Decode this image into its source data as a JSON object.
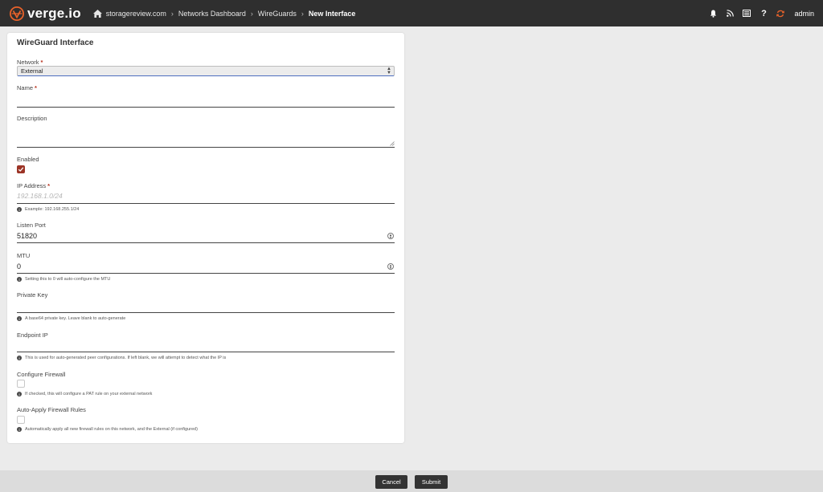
{
  "brand": {
    "name": "verge.io",
    "accent": "#e8622a"
  },
  "breadcrumbs": [
    "storagereview.com",
    "Networks Dashboard",
    "WireGuards",
    "New Interface"
  ],
  "header_icons": [
    "bell-icon",
    "rss-icon",
    "list-icon",
    "help-icon",
    "refresh-icon"
  ],
  "user": "admin",
  "form": {
    "title": "WireGuard Interface",
    "network": {
      "label": "Network",
      "value": "External"
    },
    "name": {
      "label": "Name",
      "value": ""
    },
    "description": {
      "label": "Description",
      "value": ""
    },
    "enabled": {
      "label": "Enabled",
      "checked": true
    },
    "ip_address": {
      "label": "IP Address",
      "placeholder": "192.168.1.0/24",
      "hint": "Example: 192.168.255.1/24"
    },
    "listen_port": {
      "label": "Listen Port",
      "value": "51820"
    },
    "mtu": {
      "label": "MTU",
      "value": "0",
      "hint": "Setting this to 0 will auto-configure the MTU"
    },
    "private_key": {
      "label": "Private Key",
      "value": "",
      "hint": "A base64 private key. Leave blank to auto-generate"
    },
    "endpoint_ip": {
      "label": "Endpoint IP",
      "value": "",
      "hint": "This is used for auto-generated peer configurations. If left blank, we will attempt to detect what the IP is"
    },
    "configure_firewall": {
      "label": "Configure Firewall",
      "checked": false,
      "hint": "If checked, this will configure a PAT rule on your external network"
    },
    "auto_apply": {
      "label": "Auto-Apply Firewall Rules",
      "checked": false,
      "hint": "Automatically apply all new firewall rules on this network, and the External (if configured)"
    }
  },
  "actions": {
    "cancel": "Cancel",
    "submit": "Submit"
  }
}
